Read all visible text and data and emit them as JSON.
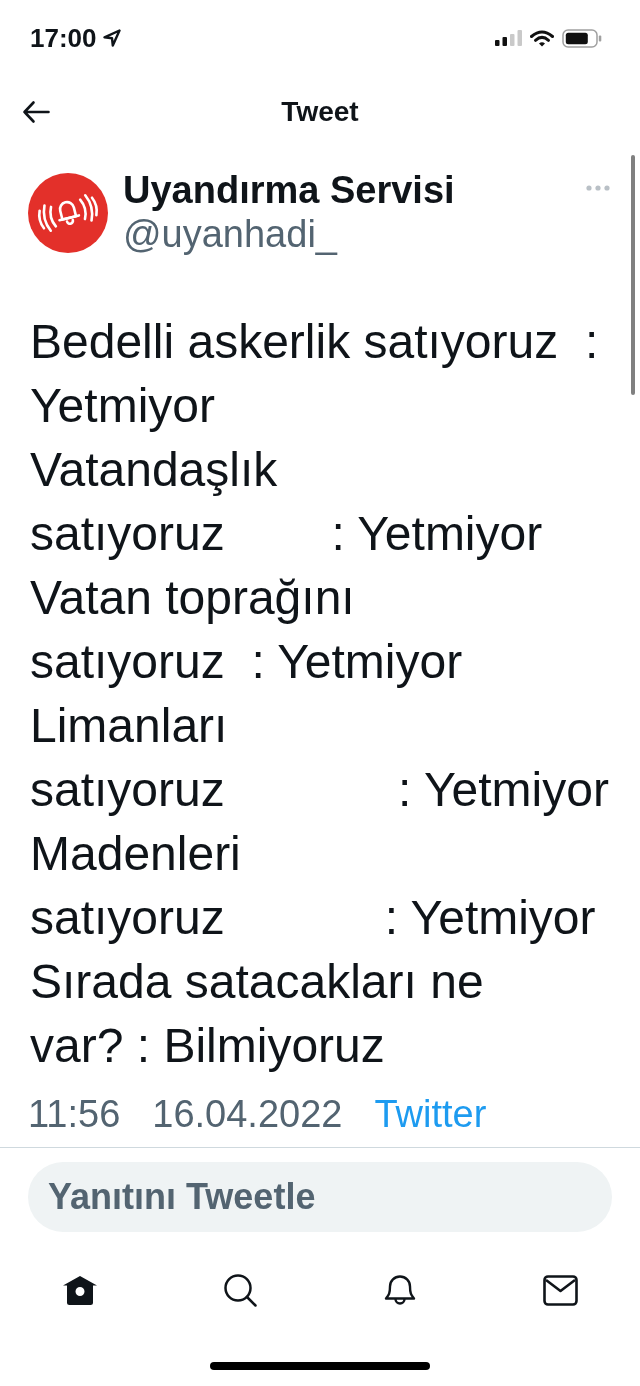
{
  "status_bar": {
    "time": "17:00"
  },
  "header": {
    "title": "Tweet"
  },
  "tweet": {
    "author": {
      "name": "Uyandırma Servisi",
      "handle": "@uyanhadi_"
    },
    "text": "Bedelli askerlik satıyoruz  :\nYetmiyor\nVatandaşlık\nsatıyoruz        : Yetmiyor\nVatan toprağını\nsatıyoruz  : Yetmiyor\nLimanları\nsatıyoruz             : Yetmiyor\nMadenleri\nsatıyoruz            : Yetmiyor\nSırada satacakları ne\nvar? : Bilmiyoruz",
    "meta": {
      "time": "11:56",
      "date": "16.04.2022",
      "source": "Twitter"
    }
  },
  "reply": {
    "placeholder": "Yanıtını Tweetle"
  },
  "tab_bar": [
    {
      "kind": "home",
      "selected": true
    },
    {
      "kind": "search",
      "selected": false
    },
    {
      "kind": "notifications",
      "selected": false
    },
    {
      "kind": "messages",
      "selected": false
    }
  ]
}
